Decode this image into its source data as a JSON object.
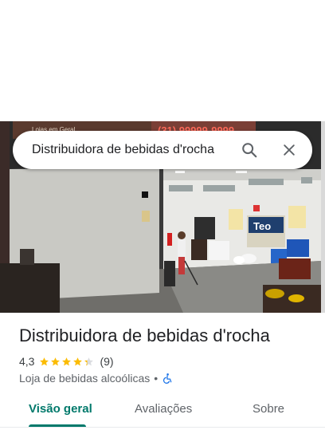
{
  "search": {
    "query": "Distribuidora de bebidas d'rocha",
    "search_icon": "search-icon",
    "close_icon": "close-icon"
  },
  "photo": {
    "banner_text": "(31) 99999-9999",
    "banner_small": "Lojas em Geral",
    "sign_text": "Teo"
  },
  "place": {
    "name": "Distribuidora de bebidas d'rocha",
    "rating": "4,3",
    "rating_value": 4.3,
    "stars_max": 5,
    "review_count": "(9)",
    "category": "Loja de bebidas alcoólicas",
    "separator": "•",
    "accessibility_icon": "wheelchair-icon"
  },
  "tabs": [
    {
      "label": "Visão geral",
      "active": true
    },
    {
      "label": "Avaliações",
      "active": false
    },
    {
      "label": "Sobre",
      "active": false
    }
  ],
  "colors": {
    "accent": "#00796b",
    "star": "#fbbc04",
    "star_empty": "#dadce0",
    "accessibility": "#1a73e8"
  }
}
